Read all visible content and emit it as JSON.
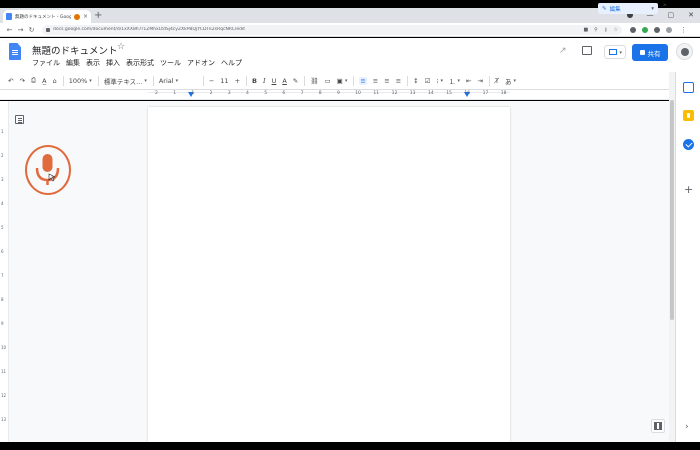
{
  "browser": {
    "tab_title": "無題のドキュメント - Google ドキュメント",
    "tab_close": "×",
    "new_tab": "+",
    "url": "docs.google.com/document/d/1xXX8h7r1ZMhxLtdSj4cyZXkPBQjYCDTk2sRqcNRC/edit",
    "window_controls": [
      "—",
      "▢",
      "✕"
    ]
  },
  "docs": {
    "title": "無題のドキュメント",
    "star": "☆",
    "menu": [
      "ファイル",
      "編集",
      "表示",
      "挿入",
      "表示形式",
      "ツール",
      "アドオン",
      "ヘルプ"
    ],
    "share_label": "共有",
    "brand_color": "#1a73e8"
  },
  "toolbar": {
    "undo": "↶",
    "redo": "↷",
    "print": "⎙",
    "spell": "A̲",
    "paint": "⌂",
    "zoom": "100%",
    "style": "標準テキス...",
    "font": "Arial",
    "minus": "−",
    "font_size": "11",
    "plus": "+",
    "bold": "B",
    "italic": "I",
    "underline": "U",
    "text_color": "A",
    "highlight": "✎",
    "link": "⛓",
    "comment": "▭",
    "image": "▣",
    "align_left": "≡",
    "align_center": "≡",
    "align_right": "≡",
    "justify": "≡",
    "line_spacing": "↕",
    "checklist": "☑",
    "bullets": "⁝",
    "numbered": "⒈",
    "outdent": "⇤",
    "indent": "⇥",
    "clear": "T̸",
    "input_tools": "あ",
    "edit_mode": "編集",
    "collapse": "⌃"
  },
  "ruler": {
    "numbers": [
      "2",
      "1",
      "1",
      "2",
      "3",
      "4",
      "5",
      "6",
      "7",
      "8",
      "9",
      "10",
      "11",
      "12",
      "13",
      "14",
      "15",
      "16",
      "17",
      "18"
    ],
    "vertical_numbers": [
      "1",
      "2",
      "3",
      "4",
      "5",
      "6",
      "7",
      "8",
      "9",
      "10",
      "11",
      "12",
      "13"
    ]
  },
  "voice_typing": {
    "icon": "microphone-icon",
    "color": "#e06b3f"
  },
  "side_panel": {
    "add": "+",
    "expand": "›"
  }
}
